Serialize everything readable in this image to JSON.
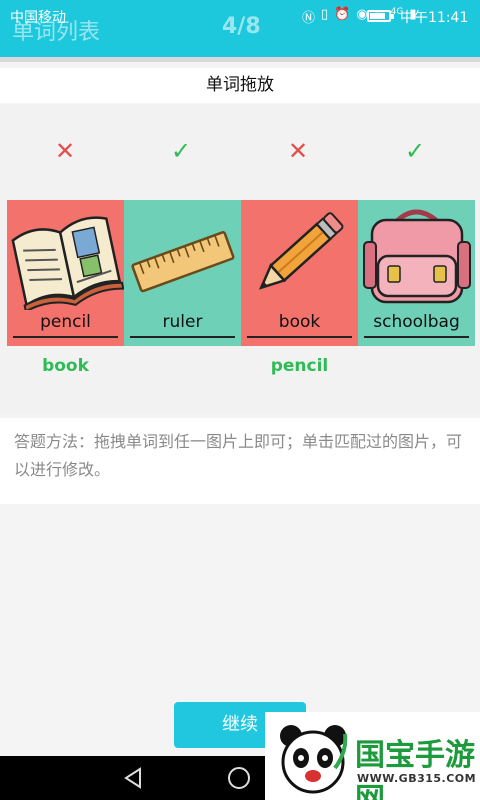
{
  "status_bar": {
    "carrier": "中国移动",
    "time": "中午11:41",
    "net": "4G",
    "battery_level": 0.85
  },
  "header": {
    "title": "单词列表",
    "progress": "4/8"
  },
  "section": {
    "title": "单词拖放"
  },
  "marks": [
    {
      "result": "wrong",
      "glyph": "✕",
      "color": "#e0504c"
    },
    {
      "result": "right",
      "glyph": "✓",
      "color": "#2fbb55"
    },
    {
      "result": "wrong",
      "glyph": "✕",
      "color": "#e0504c"
    },
    {
      "result": "right",
      "glyph": "✓",
      "color": "#2fbb55"
    }
  ],
  "cards": [
    {
      "image": "book-icon",
      "word": "pencil",
      "bg": "#f4726c",
      "placed": "book"
    },
    {
      "image": "ruler-icon",
      "word": "ruler",
      "bg": "#6ed1b7",
      "placed": ""
    },
    {
      "image": "pencil-icon",
      "word": "book",
      "bg": "#f4726c",
      "placed": "pencil"
    },
    {
      "image": "schoolbag-icon",
      "word": "schoolbag",
      "bg": "#6ed1b7",
      "placed": ""
    }
  ],
  "instructions": {
    "text": "答题方法：拖拽单词到任一图片上即可；单击匹配过的图片，可以进行修改。"
  },
  "actions": {
    "continue_label": "继续"
  },
  "watermark": {
    "text": "国宝手游网",
    "url": "WWW.GB315.COM"
  },
  "colors": {
    "accent": "#1ec8dc",
    "correct": "#2fbb55",
    "wrong": "#e0504c"
  }
}
